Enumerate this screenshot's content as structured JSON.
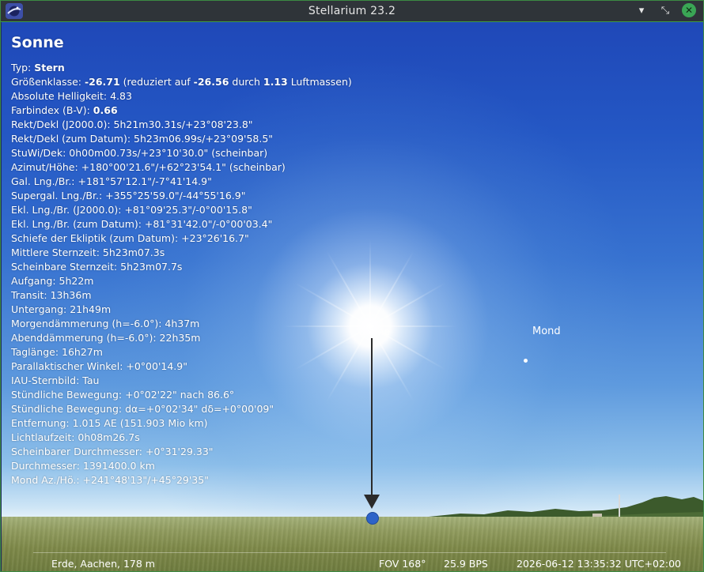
{
  "window": {
    "title": "Stellarium 23.2",
    "minimize_label": "▾",
    "maximize_label": "⤡",
    "close_label": "✕"
  },
  "object": {
    "name": "Sonne",
    "lines": [
      [
        {
          "t": "Typ: "
        },
        {
          "t": "Stern",
          "b": true
        }
      ],
      [
        {
          "t": "Größenklasse: "
        },
        {
          "t": "-26.71",
          "b": true
        },
        {
          "t": " (reduziert auf "
        },
        {
          "t": "-26.56",
          "b": true
        },
        {
          "t": " durch "
        },
        {
          "t": "1.13",
          "b": true
        },
        {
          "t": " Luftmassen)"
        }
      ],
      [
        {
          "t": "Absolute Helligkeit: 4.83"
        }
      ],
      [
        {
          "t": "Farbindex (B-V): "
        },
        {
          "t": "0.66",
          "b": true
        }
      ],
      [
        {
          "t": "Rekt/Dekl (J2000.0): 5h21m30.31s/+23°08'23.8\""
        }
      ],
      [
        {
          "t": "Rekt/Dekl (zum Datum): 5h23m06.99s/+23°09'58.5\""
        }
      ],
      [
        {
          "t": "StuWi/Dek: 0h00m00.73s/+23°10'30.0\" (scheinbar)"
        }
      ],
      [
        {
          "t": "Azimut/Höhe: +180°00'21.6\"/+62°23'54.1\" (scheinbar)"
        }
      ],
      [
        {
          "t": "Gal. Lng./Br.: +181°57'12.1\"/-7°41'14.9\""
        }
      ],
      [
        {
          "t": "Supergal. Lng./Br.: +355°25'59.0\"/-44°55'16.9\""
        }
      ],
      [
        {
          "t": "Ekl. Lng./Br. (J2000.0): +81°09'25.3\"/-0°00'15.8\""
        }
      ],
      [
        {
          "t": "Ekl. Lng./Br. (zum Datum): +81°31'42.0\"/-0°00'03.4\""
        }
      ],
      [
        {
          "t": "Schiefe der Ekliptik (zum Datum): +23°26'16.7\""
        }
      ],
      [
        {
          "t": "Mittlere Sternzeit: 5h23m07.3s"
        }
      ],
      [
        {
          "t": "Scheinbare Sternzeit: 5h23m07.7s"
        }
      ],
      [
        {
          "t": "Aufgang: 5h22m"
        }
      ],
      [
        {
          "t": "Transit: 13h36m"
        }
      ],
      [
        {
          "t": "Untergang: 21h49m"
        }
      ],
      [
        {
          "t": "Morgendämmerung (h=-6.0°): 4h37m"
        }
      ],
      [
        {
          "t": "Abenddämmerung (h=-6.0°): 22h35m"
        }
      ],
      [
        {
          "t": "Taglänge: 16h27m"
        }
      ],
      [
        {
          "t": "Parallaktischer Winkel: +0°00'14.9\""
        }
      ],
      [
        {
          "t": "IAU-Sternbild: Tau"
        }
      ],
      [
        {
          "t": "Stündliche Bewegung: +0°02'22\" nach 86.6°"
        }
      ],
      [
        {
          "t": "Stündliche Bewegung: dα=+0°02'34\" dδ=+0°00'09\""
        }
      ],
      [
        {
          "t": "Entfernung: 1.015 AE (151.903 Mio km)"
        }
      ],
      [
        {
          "t": "Lichtlaufzeit: 0h08m26.7s"
        }
      ],
      [
        {
          "t": "Scheinbarer Durchmesser: +0°31'29.33\""
        }
      ],
      [
        {
          "t": "Durchmesser: 1391400.0 km"
        }
      ],
      [
        {
          "t": "Mond Az./Hö.: +241°48'13\"/+45°29'35\""
        }
      ]
    ]
  },
  "sky_labels": {
    "sun": "Sonne",
    "moon": "Mond"
  },
  "status": {
    "location": "Erde, Aachen, 178 m",
    "fov": "FOV 168°",
    "fps": "25.9 BPS",
    "datetime": "2026-06-12 13:35:32 UTC+02:00"
  },
  "colors": {
    "sky_top": "#1f48b8",
    "pointer_dot": "#2d63c8",
    "close_button": "#3aa655",
    "titlebar": "#2f3439"
  }
}
